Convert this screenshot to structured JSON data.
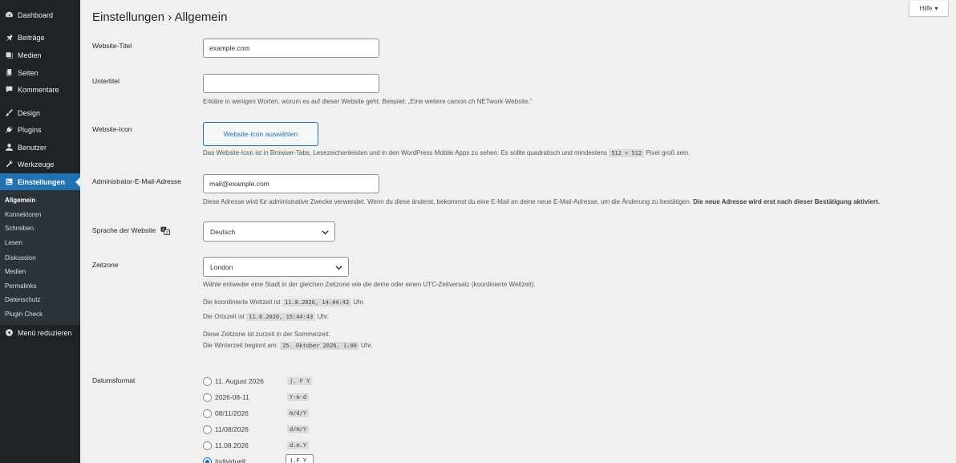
{
  "sidebar": {
    "items": [
      {
        "label": "Dashboard",
        "icon": "dashboard-icon"
      },
      {
        "label": "Beiträge",
        "icon": "pin-icon"
      },
      {
        "label": "Medien",
        "icon": "media-icon"
      },
      {
        "label": "Seiten",
        "icon": "pages-icon"
      },
      {
        "label": "Kommentare",
        "icon": "comment-icon"
      },
      {
        "label": "Design",
        "icon": "brush-icon"
      },
      {
        "label": "Plugins",
        "icon": "plugin-icon"
      },
      {
        "label": "Benutzer",
        "icon": "user-icon"
      },
      {
        "label": "Werkzeuge",
        "icon": "wrench-icon"
      },
      {
        "label": "Einstellungen",
        "icon": "settings-icon"
      }
    ],
    "submenu": [
      "Allgemein",
      "Konnektoren",
      "Schreiben",
      "Lesen",
      "Diskussion",
      "Medien",
      "Permalinks",
      "Datenschutz",
      "Plugin Check"
    ],
    "collapse_label": "Menü reduzieren"
  },
  "page": {
    "title": "Einstellungen › Allgemein",
    "help_label": "Hilfe"
  },
  "fields": {
    "site_title": {
      "label": "Website-Titel",
      "value": "example.com"
    },
    "tagline": {
      "label": "Untertitel",
      "value": "",
      "desc": "Erkläre in wenigen Worten, worum es auf dieser Website geht. Beispiel: „Eine weitere carson.ch NETwork-Website.“"
    },
    "site_icon": {
      "label": "Website-Icon",
      "button": "Website-Icon auswählen",
      "desc_a": "Das Website-Icon ist in Browser-Tabs, Lesezeichenleisten und in den WordPress Mobile Apps zu sehen. Es sollte quadratisch und mindestens",
      "desc_code": "512 × 512",
      "desc_b": "Pixel groß sein."
    },
    "admin_email": {
      "label": "Administrator-E-Mail-Adresse",
      "value": "mail@example.com",
      "desc": "Diese Adresse wird für administrative Zwecke verwendet. Wenn du diese änderst, bekommst du eine E-Mail an deine neue E-Mail-Adresse, um die Änderung zu bestätigen.",
      "desc_bold": "Die neue Adresse wird erst nach dieser Bestätigung aktiviert."
    },
    "language": {
      "label": "Sprache der Website",
      "value": "Deutsch"
    },
    "timezone": {
      "label": "Zeitzone",
      "value": "London",
      "desc": "Wähle entweder eine Stadt in der gleichen Zeitzone wie die deine oder einen UTC-Zeitversatz (koordinierte Weltzeit).",
      "utc_prefix": "Die koordinierte Weltzeit ist",
      "utc_value": "11.8.2026, 14:44:43",
      "utc_suffix": "Uhr.",
      "local_prefix": "Die Ortszeit ist",
      "local_value": "11.8.2026, 15:44:43",
      "local_suffix": "Uhr.",
      "dst_note": "Diese Zeitzone ist zurzeit in der Sommerzeit.",
      "winter_prefix": "Die Winterzeit beginnt am:",
      "winter_value": "25. Oktober 2026, 1:00",
      "winter_suffix": "Uhr."
    },
    "date_format": {
      "label": "Datumsformat",
      "options": [
        {
          "label": "11. August 2026",
          "code": "j. F Y",
          "checked": false
        },
        {
          "label": "2026-08-11",
          "code": "Y-m-d",
          "checked": false
        },
        {
          "label": "08/11/2026",
          "code": "m/d/Y",
          "checked": false
        },
        {
          "label": "11/08/2026",
          "code": "d/m/Y",
          "checked": false
        },
        {
          "label": "11.08.2026",
          "code": "d.m.Y",
          "checked": false
        },
        {
          "label": "Individuell:",
          "code": "",
          "checked": true
        }
      ],
      "custom_value": "j.F Y"
    }
  },
  "colors": {
    "accent": "#2271b1",
    "sidebar_bg": "#1d2327",
    "page_bg": "#f0f0f1"
  }
}
